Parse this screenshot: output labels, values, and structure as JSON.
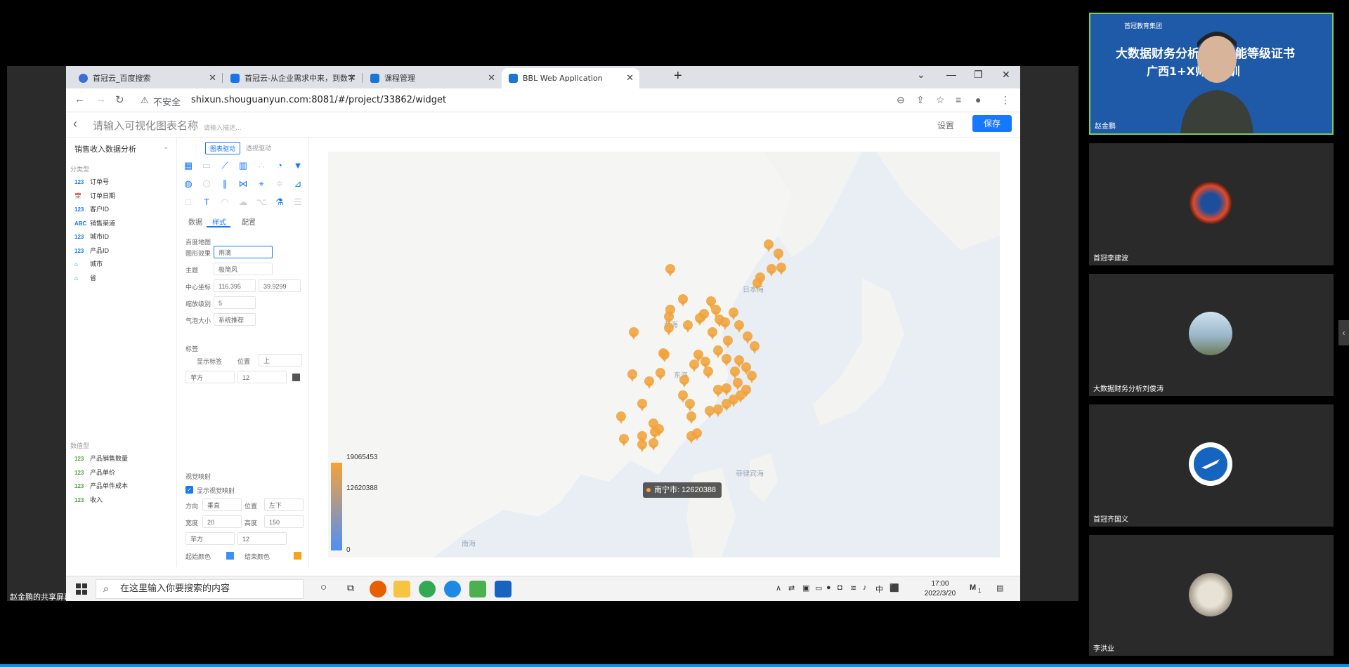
{
  "browser": {
    "tabs": [
      {
        "title": "首冠云_百度搜索",
        "color": "#3b6fd8"
      },
      {
        "title": "首冠云-从企业需求中来，到数字",
        "color": "#1a73e8"
      },
      {
        "title": "课程管理",
        "color": "#1976d2"
      },
      {
        "title": "BBL Web Application",
        "color": "#1976d2"
      }
    ],
    "new_tab": "+",
    "insecure_label": "不安全",
    "url": "shixun.shouguanyun.com:8081/#/project/33862/widget"
  },
  "app": {
    "chart_name_placeholder": "请输入可视化图表名称",
    "description_placeholder": "请输入描述...",
    "settings_label": "设置",
    "save_label": "保存",
    "view_name": "销售收入数据分析",
    "category_title": "分类型",
    "category_fields": [
      {
        "type": "123",
        "label": "订单号"
      },
      {
        "type": "📅",
        "label": "订单日期"
      },
      {
        "type": "123",
        "label": "客户ID"
      },
      {
        "type": "ABC",
        "label": "销售渠道"
      },
      {
        "type": "123",
        "label": "城市ID"
      },
      {
        "type": "123",
        "label": "产品ID"
      },
      {
        "type": "⌂",
        "label": "城市"
      },
      {
        "type": "⌂",
        "label": "省"
      }
    ],
    "measure_title": "数值型",
    "measure_fields": [
      {
        "type": "123",
        "label": "产品销售数量"
      },
      {
        "type": "123",
        "label": "产品单价"
      },
      {
        "type": "123",
        "label": "产品单件成本"
      },
      {
        "type": "123",
        "label": "收入"
      }
    ],
    "drive_tabs": [
      "图表驱动",
      "透视驱动"
    ],
    "sub_tabs": [
      "数据",
      "样式",
      "配置"
    ],
    "style": {
      "section_map": "百度地图",
      "effect_label": "图形效果",
      "effect_value": "雨滴",
      "theme_label": "主题",
      "theme_value": "极简风",
      "center_label": "中心坐标",
      "center_lng": "116.395",
      "center_lat": "39.9299",
      "zoom_label": "缩放级别",
      "zoom_value": "5",
      "bubble_label": "气泡大小",
      "bubble_value": "系统推荐",
      "section_label": "标签",
      "show_label": "显示标签",
      "position_label": "位置",
      "position_value": "上",
      "font_value": "苹方",
      "font_size": "12",
      "section_visual": "视觉映射",
      "show_visual": "显示视觉映射",
      "direction_label": "方向",
      "direction_value": "垂直",
      "vposition_label": "位置",
      "vposition_value": "左下",
      "width_label": "宽度",
      "width_value": "20",
      "height_label": "高度",
      "height_value": "150",
      "vfont_value": "苹方",
      "vfont_size": "12",
      "start_color_label": "起始颜色",
      "start_color": "#3d8ef5",
      "end_color_label": "结束颜色",
      "end_color": "#f7a21c"
    }
  },
  "map": {
    "legend_max": "19065453",
    "legend_mid": "12620388",
    "legend_min": "0",
    "tooltip": "南宁市: 12620388",
    "seas": [
      "黄海",
      "东海",
      "日本海",
      "南海",
      "菲律宾海"
    ]
  },
  "taskbar": {
    "search_placeholder": "在这里输入你要搜索的内容",
    "time": "17:00",
    "date": "2022/3/20",
    "ime": "中",
    "notif_count": "1"
  },
  "meeting": {
    "share_label": "赵金鹏的共享屏幕",
    "banner_top": "首冠教育集团",
    "banner_line1": "大数据财务分析职业技能等级证书",
    "banner_line2": "广西1+X师资培训",
    "participants": [
      {
        "name": "赵金鹏"
      },
      {
        "name": "首冠李建波"
      },
      {
        "name": "大数据财务分析刘俊涛"
      },
      {
        "name": "首冠齐国义"
      },
      {
        "name": "李洪业"
      }
    ]
  }
}
